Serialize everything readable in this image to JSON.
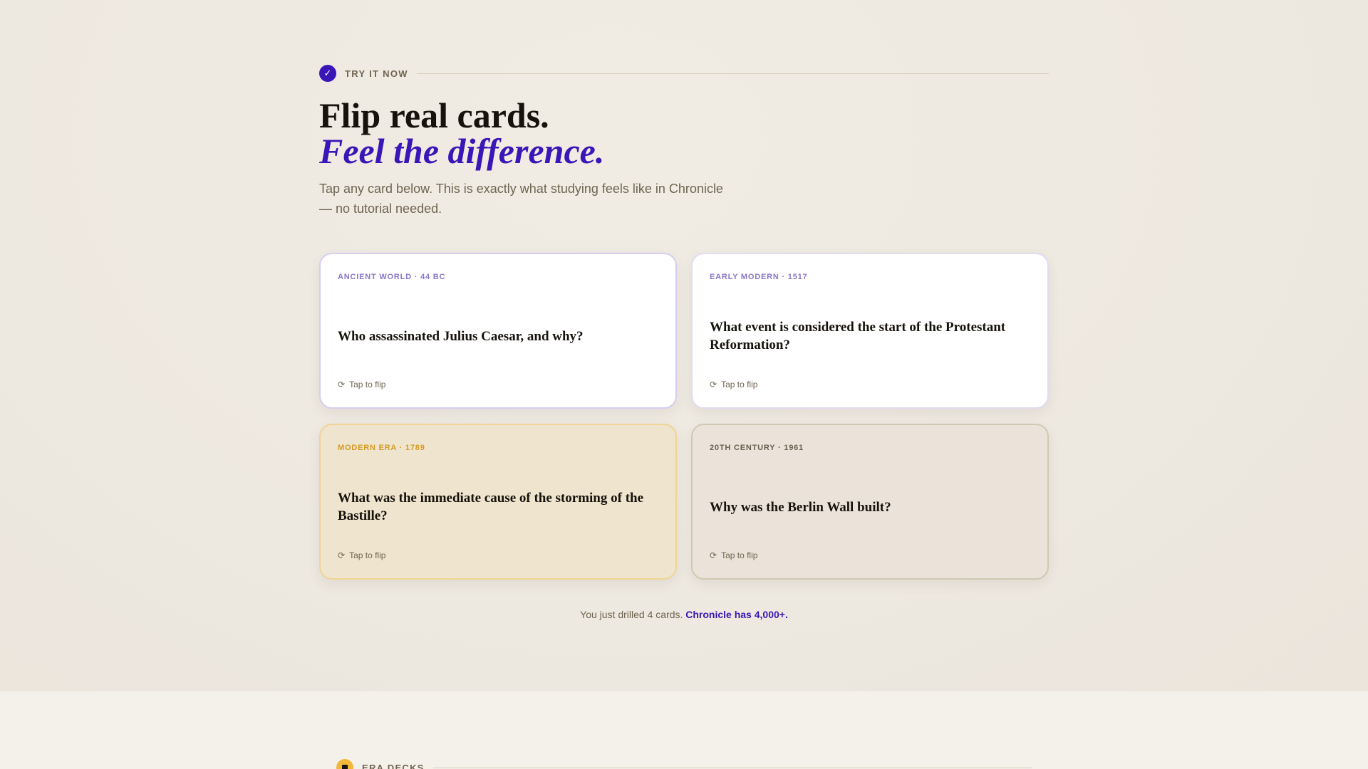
{
  "colors": {
    "accent": "#3a16b8",
    "gold": "#f0b73a",
    "text_dark": "#16120c",
    "text_muted": "#6f6450"
  },
  "eyebrow": {
    "icon": "check-icon",
    "label": "TRY IT NOW"
  },
  "hero": {
    "title": "Flip real cards.",
    "title_italic": "Feel the difference.",
    "subtitle": "Tap any card below. This is exactly what studying feels like in Chronicle — no tutorial needed."
  },
  "cards": [
    {
      "era": "ANCIENT WORLD · 44 BC",
      "question": "Who assassinated Julius Caesar, and why?",
      "flip_label": "Tap to flip"
    },
    {
      "era": "EARLY MODERN · 1517",
      "question": "What event is considered the start of the Protestant Reformation?",
      "flip_label": "Tap to flip"
    },
    {
      "era": "MODERN ERA · 1789",
      "question": "What was the immediate cause of the storming of the Bastille?",
      "flip_label": "Tap to flip"
    },
    {
      "era": "20TH CENTURY · 1961",
      "question": "Why was the Berlin Wall built?",
      "flip_label": "Tap to flip"
    }
  ],
  "footnote": {
    "text": "You just drilled 4 cards.",
    "cta": "Chronicle has 4,000+."
  },
  "next_section": {
    "icon": "deck-icon",
    "label": "ERA DECKS"
  }
}
